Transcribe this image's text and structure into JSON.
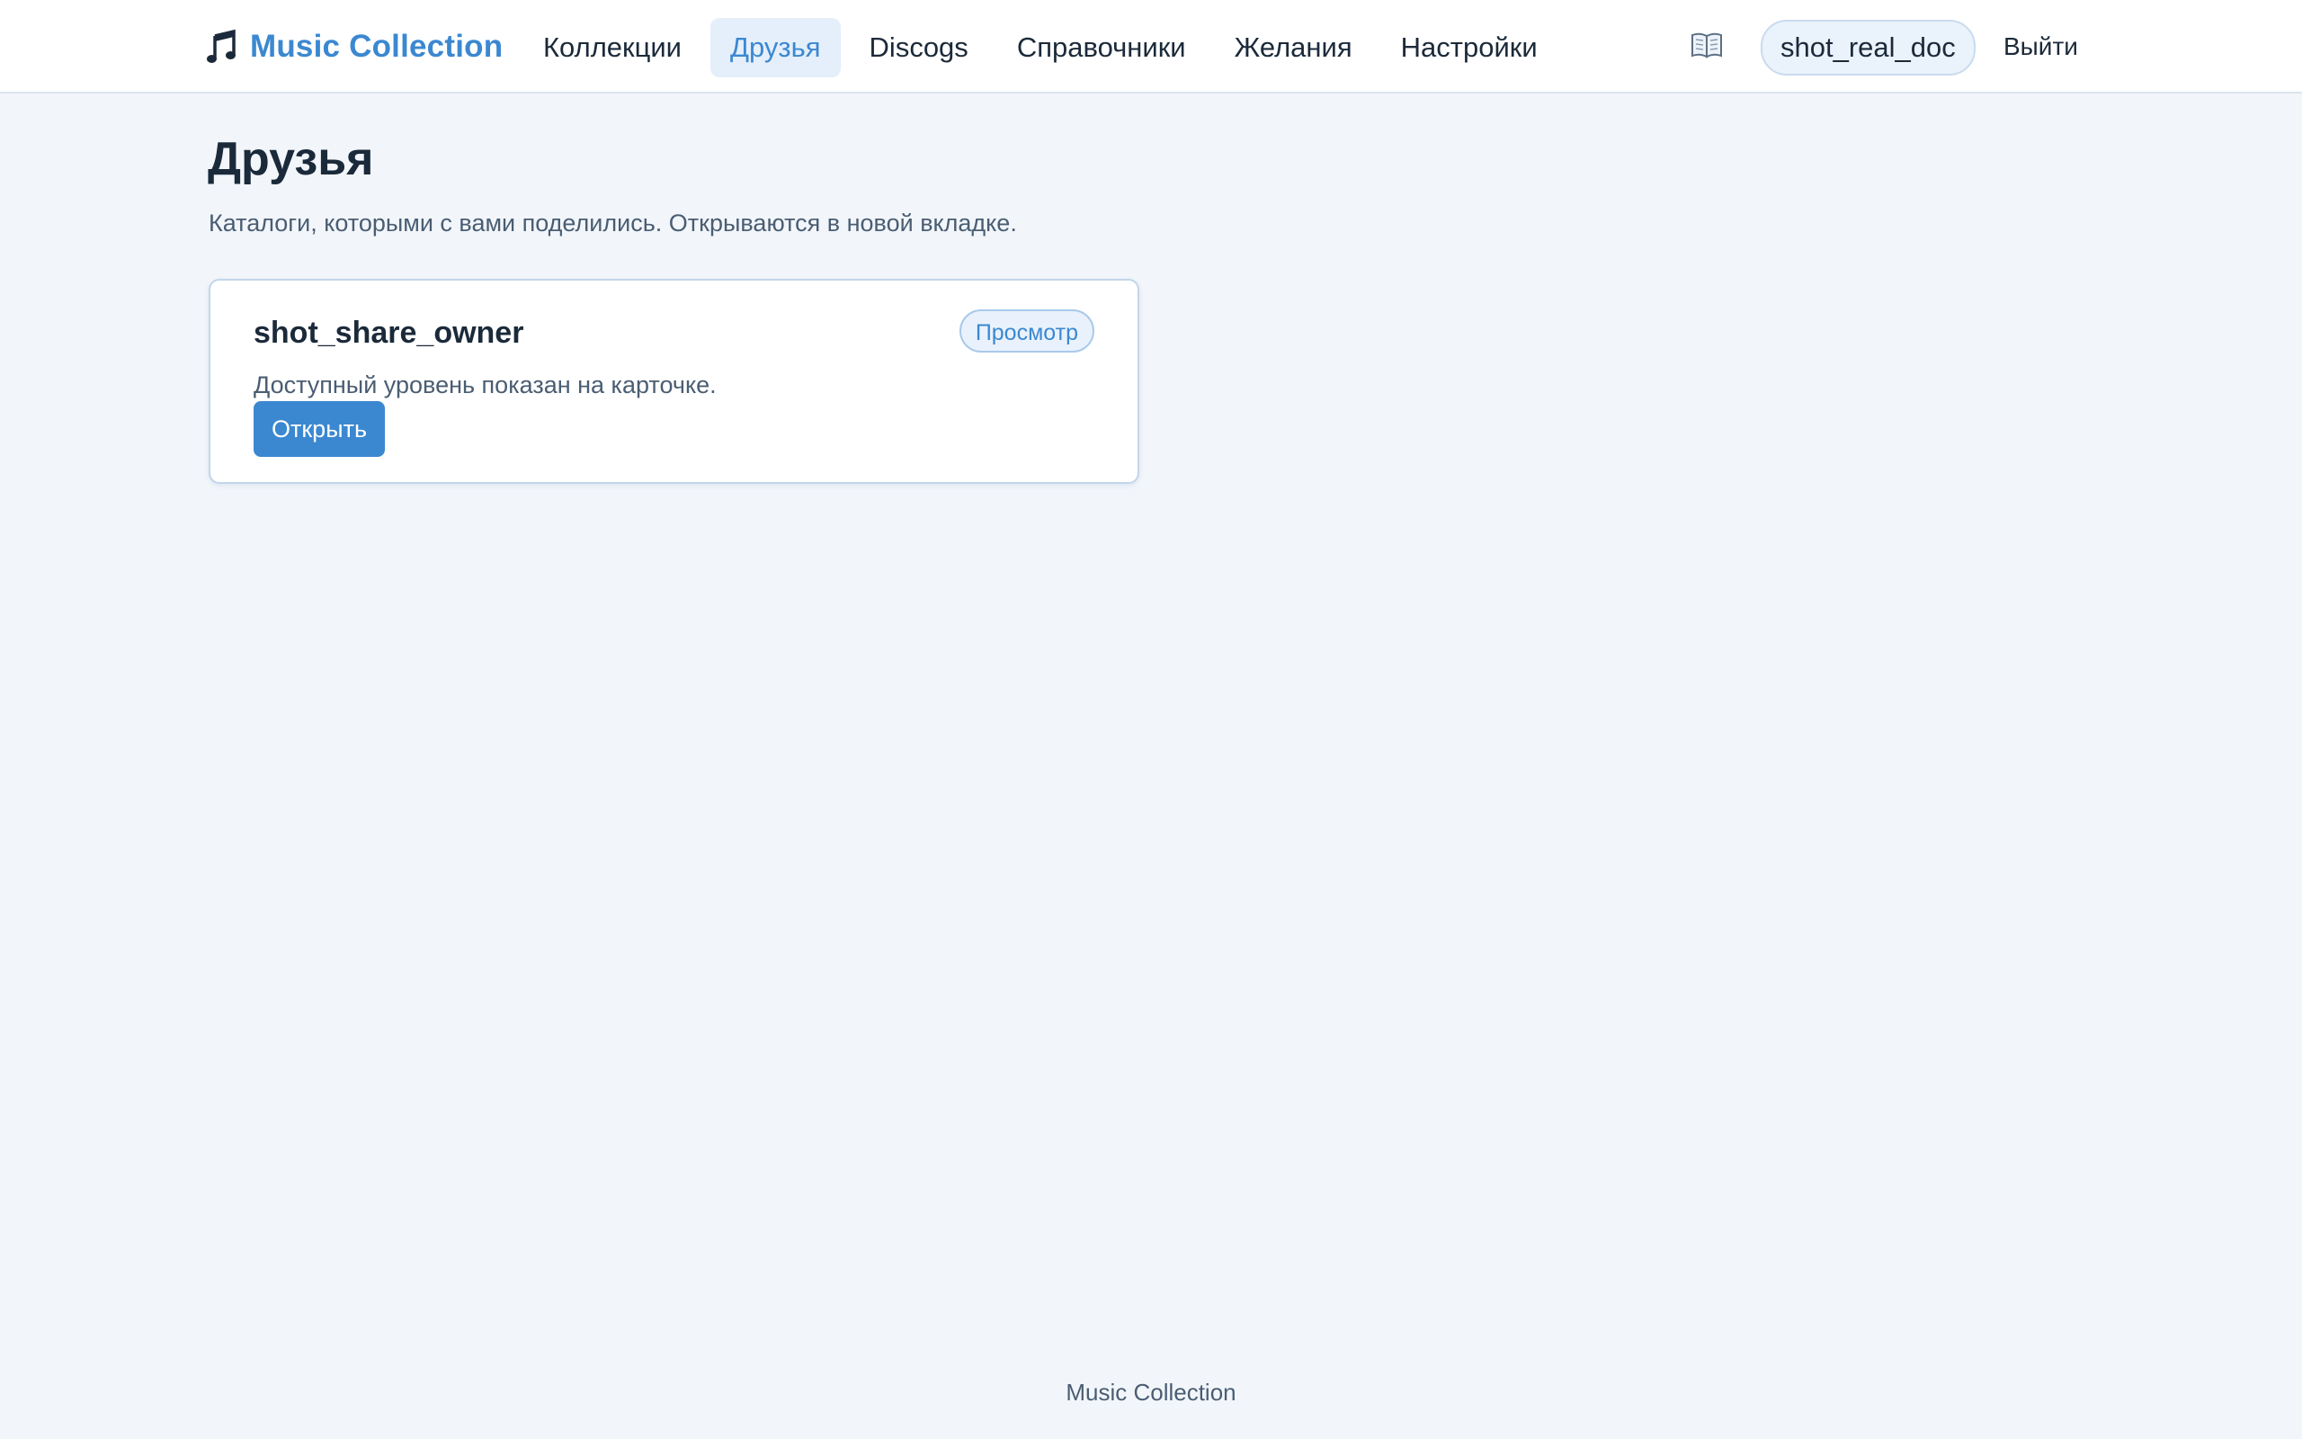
{
  "header": {
    "brand_title": "Music Collection",
    "brand_icon": "music-note-icon",
    "nav": {
      "collections": "Коллекции",
      "friends": "Друзья",
      "discogs": "Discogs",
      "references": "Справочники",
      "wishes": "Желания",
      "settings": "Настройки"
    },
    "active_nav": "friends",
    "docs_icon": "open-book-icon",
    "username": "shot_real_doc",
    "logout_label": "Выйти"
  },
  "main": {
    "title": "Друзья",
    "subtitle": "Каталоги, которыми с вами поделились. Открываются в новой вкладке.",
    "shares": [
      {
        "owner": "shot_share_owner",
        "access_badge": "Просмотр",
        "description": "Доступный уровень показан на карточке.",
        "open_label": "Открыть"
      }
    ]
  },
  "footer": {
    "text": "Music Collection"
  },
  "colors": {
    "accent": "#3b88d1",
    "background": "#f2f6fb",
    "active_nav_bg": "#e4effb",
    "text": "#1b2a3a",
    "muted_text": "#4a5d72"
  }
}
